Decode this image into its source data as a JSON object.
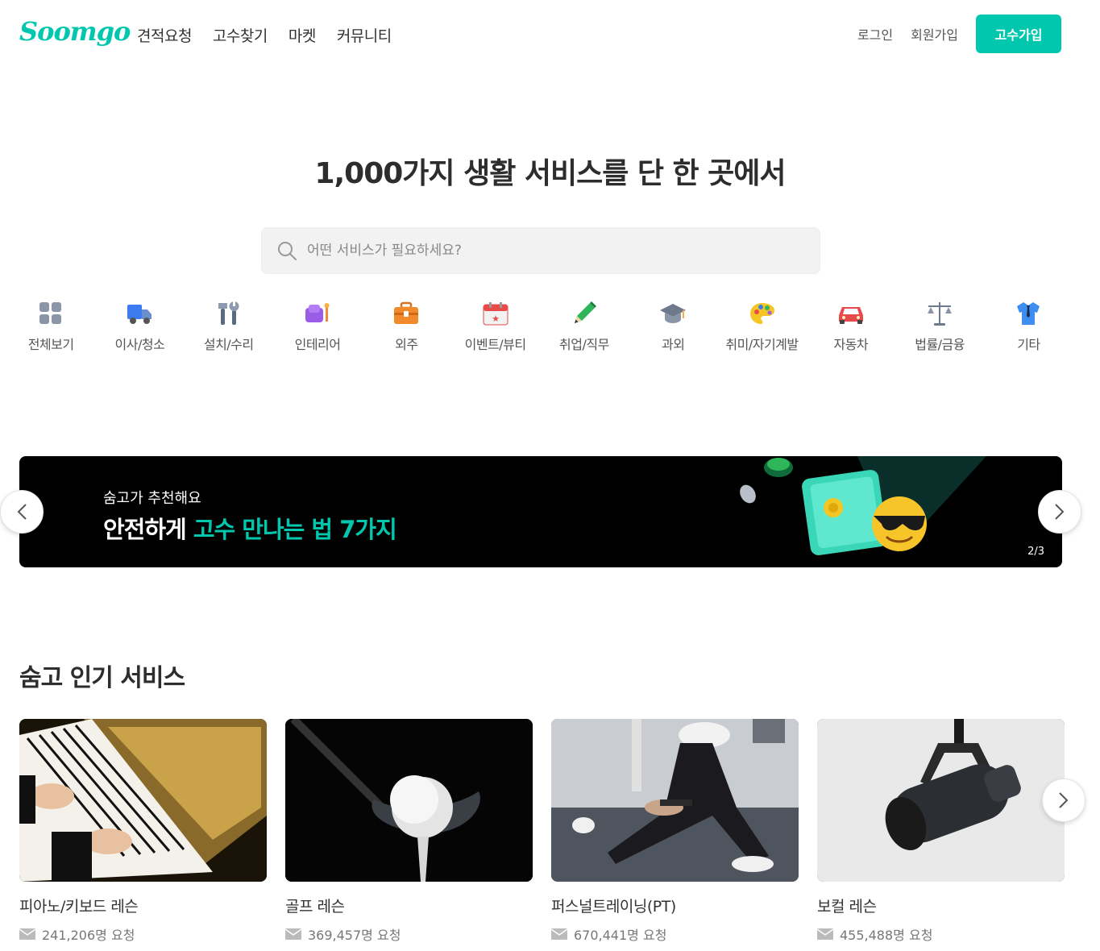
{
  "header": {
    "logo": "Soomgo",
    "nav": [
      "견적요청",
      "고수찾기",
      "마켓",
      "커뮤니티"
    ],
    "login": "로그인",
    "signup": "회원가입",
    "pro_signup": "고수가입"
  },
  "hero": {
    "title": "1,000가지 생활 서비스를 단 한 곳에서",
    "search_placeholder": "어떤 서비스가 필요하세요?"
  },
  "categories": [
    {
      "label": "전체보기",
      "icon": "grid-icon"
    },
    {
      "label": "이사/청소",
      "icon": "truck-icon"
    },
    {
      "label": "설치/수리",
      "icon": "tools-icon"
    },
    {
      "label": "인테리어",
      "icon": "sofa-icon"
    },
    {
      "label": "외주",
      "icon": "briefcase-icon"
    },
    {
      "label": "이벤트/뷰티",
      "icon": "calendar-icon"
    },
    {
      "label": "취업/직무",
      "icon": "pencil-icon"
    },
    {
      "label": "과외",
      "icon": "graduation-cap-icon"
    },
    {
      "label": "취미/자기계발",
      "icon": "palette-icon"
    },
    {
      "label": "자동차",
      "icon": "car-icon"
    },
    {
      "label": "법률/금융",
      "icon": "scale-icon"
    },
    {
      "label": "기타",
      "icon": "shirt-icon"
    }
  ],
  "banner": {
    "subtitle": "숨고가 추천해요",
    "title_plain": "안전하게",
    "title_highlight": "고수 만나는 법 7가지",
    "page": "2/3"
  },
  "popular": {
    "title": "숨고 인기 서비스",
    "items": [
      {
        "name": "피아노/키보드 레슨",
        "count": "241,206명 요청"
      },
      {
        "name": "골프 레슨",
        "count": "369,457명 요청"
      },
      {
        "name": "퍼스널트레이닝(PT)",
        "count": "670,441명 요청"
      },
      {
        "name": "보컬 레슨",
        "count": "455,488명 요청"
      }
    ]
  },
  "colors": {
    "accent": "#00c7ae",
    "text": "#323232",
    "muted": "#777777"
  }
}
